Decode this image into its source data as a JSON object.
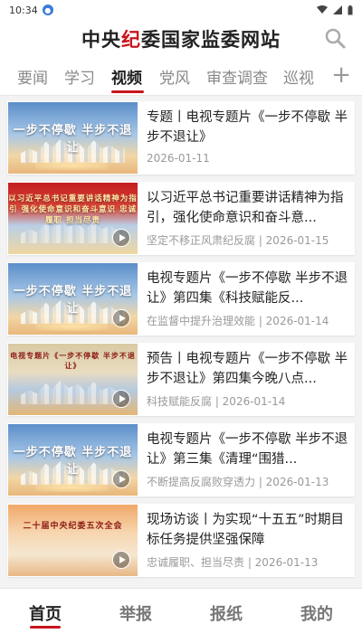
{
  "status_bar": {
    "time": "10:34",
    "notif_icon": "app-notification-icon"
  },
  "header": {
    "title_prefix": "中央",
    "title_highlight": "纪",
    "title_suffix": "委国家监委网站",
    "accent_color": "#c8161d"
  },
  "tabs": [
    {
      "label": "要闻",
      "active": false
    },
    {
      "label": "学习",
      "active": false
    },
    {
      "label": "视频",
      "active": true
    },
    {
      "label": "党风",
      "active": false
    },
    {
      "label": "审查调查",
      "active": false
    },
    {
      "label": "巡视",
      "active": false
    }
  ],
  "articles": [
    {
      "title": "专题丨电视专题片《一步不停歇 半步不退让》",
      "meta": "2026-01-11",
      "thumb_text": "一步不停歇 半步不退让",
      "play": false
    },
    {
      "title": "以习近平总书记重要讲话精神为指引，强化使命意识和奋斗意...",
      "meta": "坚定不移正风肃纪反腐 | 2026-01-15",
      "thumb_text": "以习近平总书记重要讲话精神为指引 强化使命意识和奋斗意识 忠诚履职 担当尽责",
      "play": true
    },
    {
      "title": "电视专题片《一步不停歇 半步不退让》第四集《科技赋能反...",
      "meta": "在监督中提升治理效能 | 2026-01-14",
      "thumb_text": "一步不停歇 半步不退让",
      "play": true
    },
    {
      "title": "预告丨电视专题片《一步不停歇 半步不退让》第四集今晚八点...",
      "meta": "科技赋能反腐 | 2026-01-14",
      "thumb_text": "电视专题片《一步不停歇 半步不退让》",
      "play": true
    },
    {
      "title": "电视专题片《一步不停歇 半步不退让》第三集《清理“围猎...",
      "meta": "不断提高反腐败穿透力 | 2026-01-13",
      "thumb_text": "一步不停歇 半步不退让",
      "play": true
    },
    {
      "title": "现场访谈丨为实现“十五五”时期目标任务提供坚强保障",
      "meta": "忠诚履职、担当尽责 | 2026-01-13",
      "thumb_text": "二十届中央纪委五次全会",
      "play": true
    }
  ],
  "bottom_nav": [
    {
      "label": "首页",
      "active": true
    },
    {
      "label": "举报",
      "active": false
    },
    {
      "label": "报纸",
      "active": false
    },
    {
      "label": "我的",
      "active": false
    }
  ]
}
